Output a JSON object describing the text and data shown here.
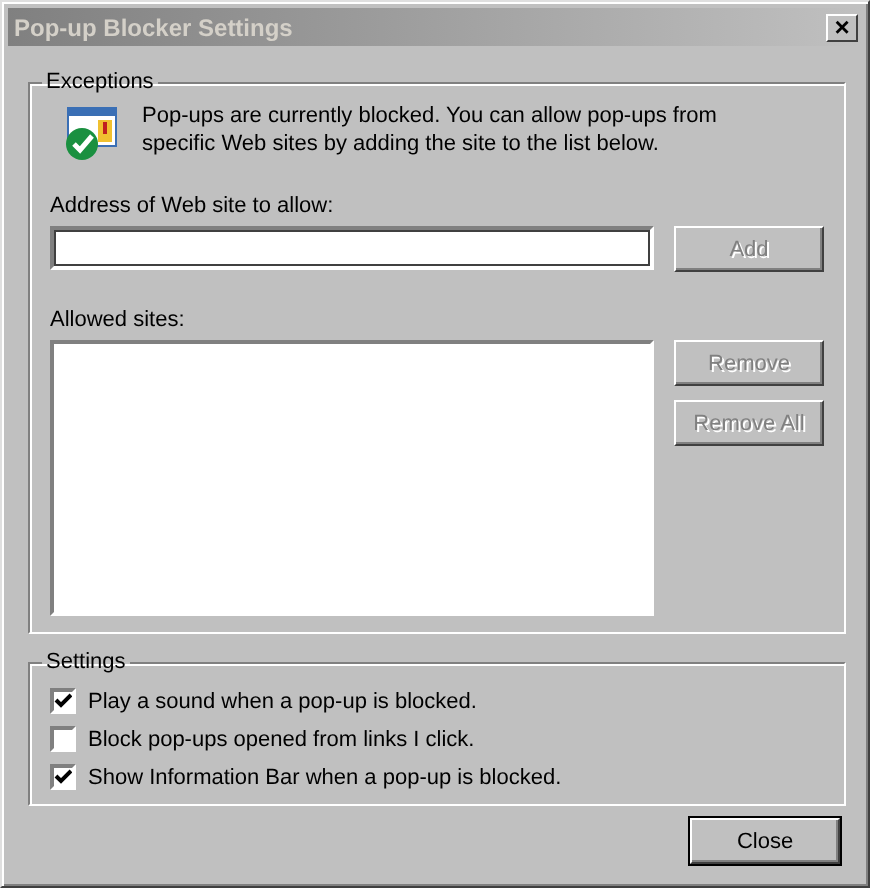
{
  "window": {
    "title": "Pop-up Blocker Settings",
    "close": "×",
    "active": false
  },
  "exceptions": {
    "title": "Exceptions",
    "info": "Pop-ups are currently blocked.  You can allow pop-ups from specific Web sites by adding the site to the list below.",
    "address_label": "Address of Web site to allow:",
    "add_button": {
      "label": "Add",
      "disabled": true
    },
    "allowed_label": "Allowed sites:",
    "buttons": [
      {
        "label": "Remove",
        "disabled": true
      },
      {
        "label": "Remove All",
        "disabled": true
      }
    ]
  },
  "settings": {
    "title": "Settings",
    "options": [
      {
        "label": "Play a sound when a pop-up is blocked.",
        "checked": true
      },
      {
        "label": "Block pop-ups opened from links I click.",
        "checked": false
      },
      {
        "label": "Show Information Bar when a pop-up is blocked.",
        "checked": true
      }
    ]
  },
  "close_button": {
    "label": "Close",
    "default": true
  }
}
